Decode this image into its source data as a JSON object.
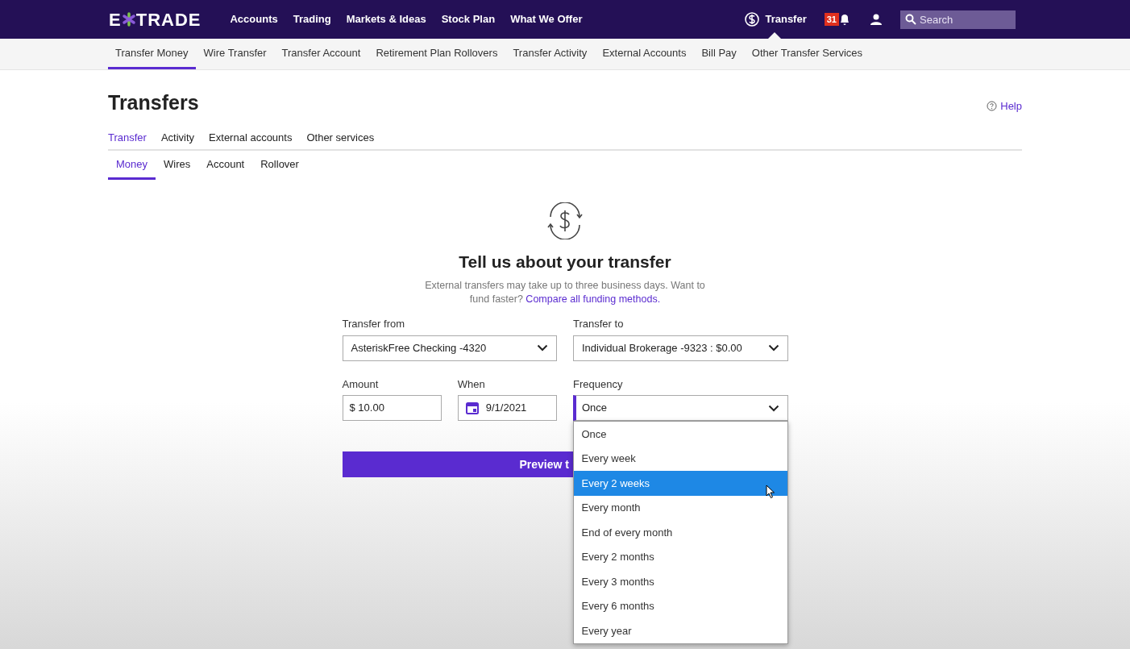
{
  "topbar": {
    "logo": {
      "left": "E",
      "right": "TRADE"
    },
    "nav": [
      "Accounts",
      "Trading",
      "Markets & Ideas",
      "Stock Plan",
      "What We Offer"
    ],
    "transfer": "Transfer",
    "badge": "31",
    "search": {
      "placeholder": "Search"
    }
  },
  "subnav": [
    {
      "label": "Transfer Money",
      "selected": true
    },
    {
      "label": "Wire Transfer",
      "selected": false
    },
    {
      "label": "Transfer Account",
      "selected": false
    },
    {
      "label": "Retirement Plan Rollovers",
      "selected": false
    },
    {
      "label": "Transfer Activity",
      "selected": false
    },
    {
      "label": "External Accounts",
      "selected": false
    },
    {
      "label": "Bill Pay",
      "selected": false
    },
    {
      "label": "Other Transfer Services",
      "selected": false
    }
  ],
  "page": {
    "title": "Transfers",
    "help": "Help"
  },
  "tabs": [
    {
      "label": "Transfer",
      "selected": true
    },
    {
      "label": "Activity",
      "selected": false
    },
    {
      "label": "External accounts",
      "selected": false
    },
    {
      "label": "Other services",
      "selected": false
    }
  ],
  "subtabs": [
    {
      "label": "Money",
      "selected": true
    },
    {
      "label": "Wires",
      "selected": false
    },
    {
      "label": "Account",
      "selected": false
    },
    {
      "label": "Rollover",
      "selected": false
    }
  ],
  "form": {
    "heading": "Tell us about your transfer",
    "note": "External transfers may take up to three business days. Want to fund faster?",
    "link": "Compare all funding methods.",
    "from": {
      "label": "Transfer from",
      "value": "AsteriskFree Checking -4320"
    },
    "to": {
      "label": "Transfer to",
      "value": "Individual Brokerage -9323 : $0.00"
    },
    "amount": {
      "label": "Amount",
      "value": "$ 10.00"
    },
    "when": {
      "label": "When",
      "value": "9/1/2021"
    },
    "frequency": {
      "label": "Frequency",
      "value": "Once",
      "expanded": true,
      "options": [
        {
          "label": "Once",
          "highlighted": false
        },
        {
          "label": "Every week",
          "highlighted": false
        },
        {
          "label": "Every 2 weeks",
          "highlighted": true
        },
        {
          "label": "Every month",
          "highlighted": false
        },
        {
          "label": "End of every month",
          "highlighted": false
        },
        {
          "label": "Every 2 months",
          "highlighted": false
        },
        {
          "label": "Every 3 months",
          "highlighted": false
        },
        {
          "label": "Every 6 months",
          "highlighted": false
        },
        {
          "label": "Every year",
          "highlighted": false
        }
      ]
    },
    "button": "Preview t"
  }
}
